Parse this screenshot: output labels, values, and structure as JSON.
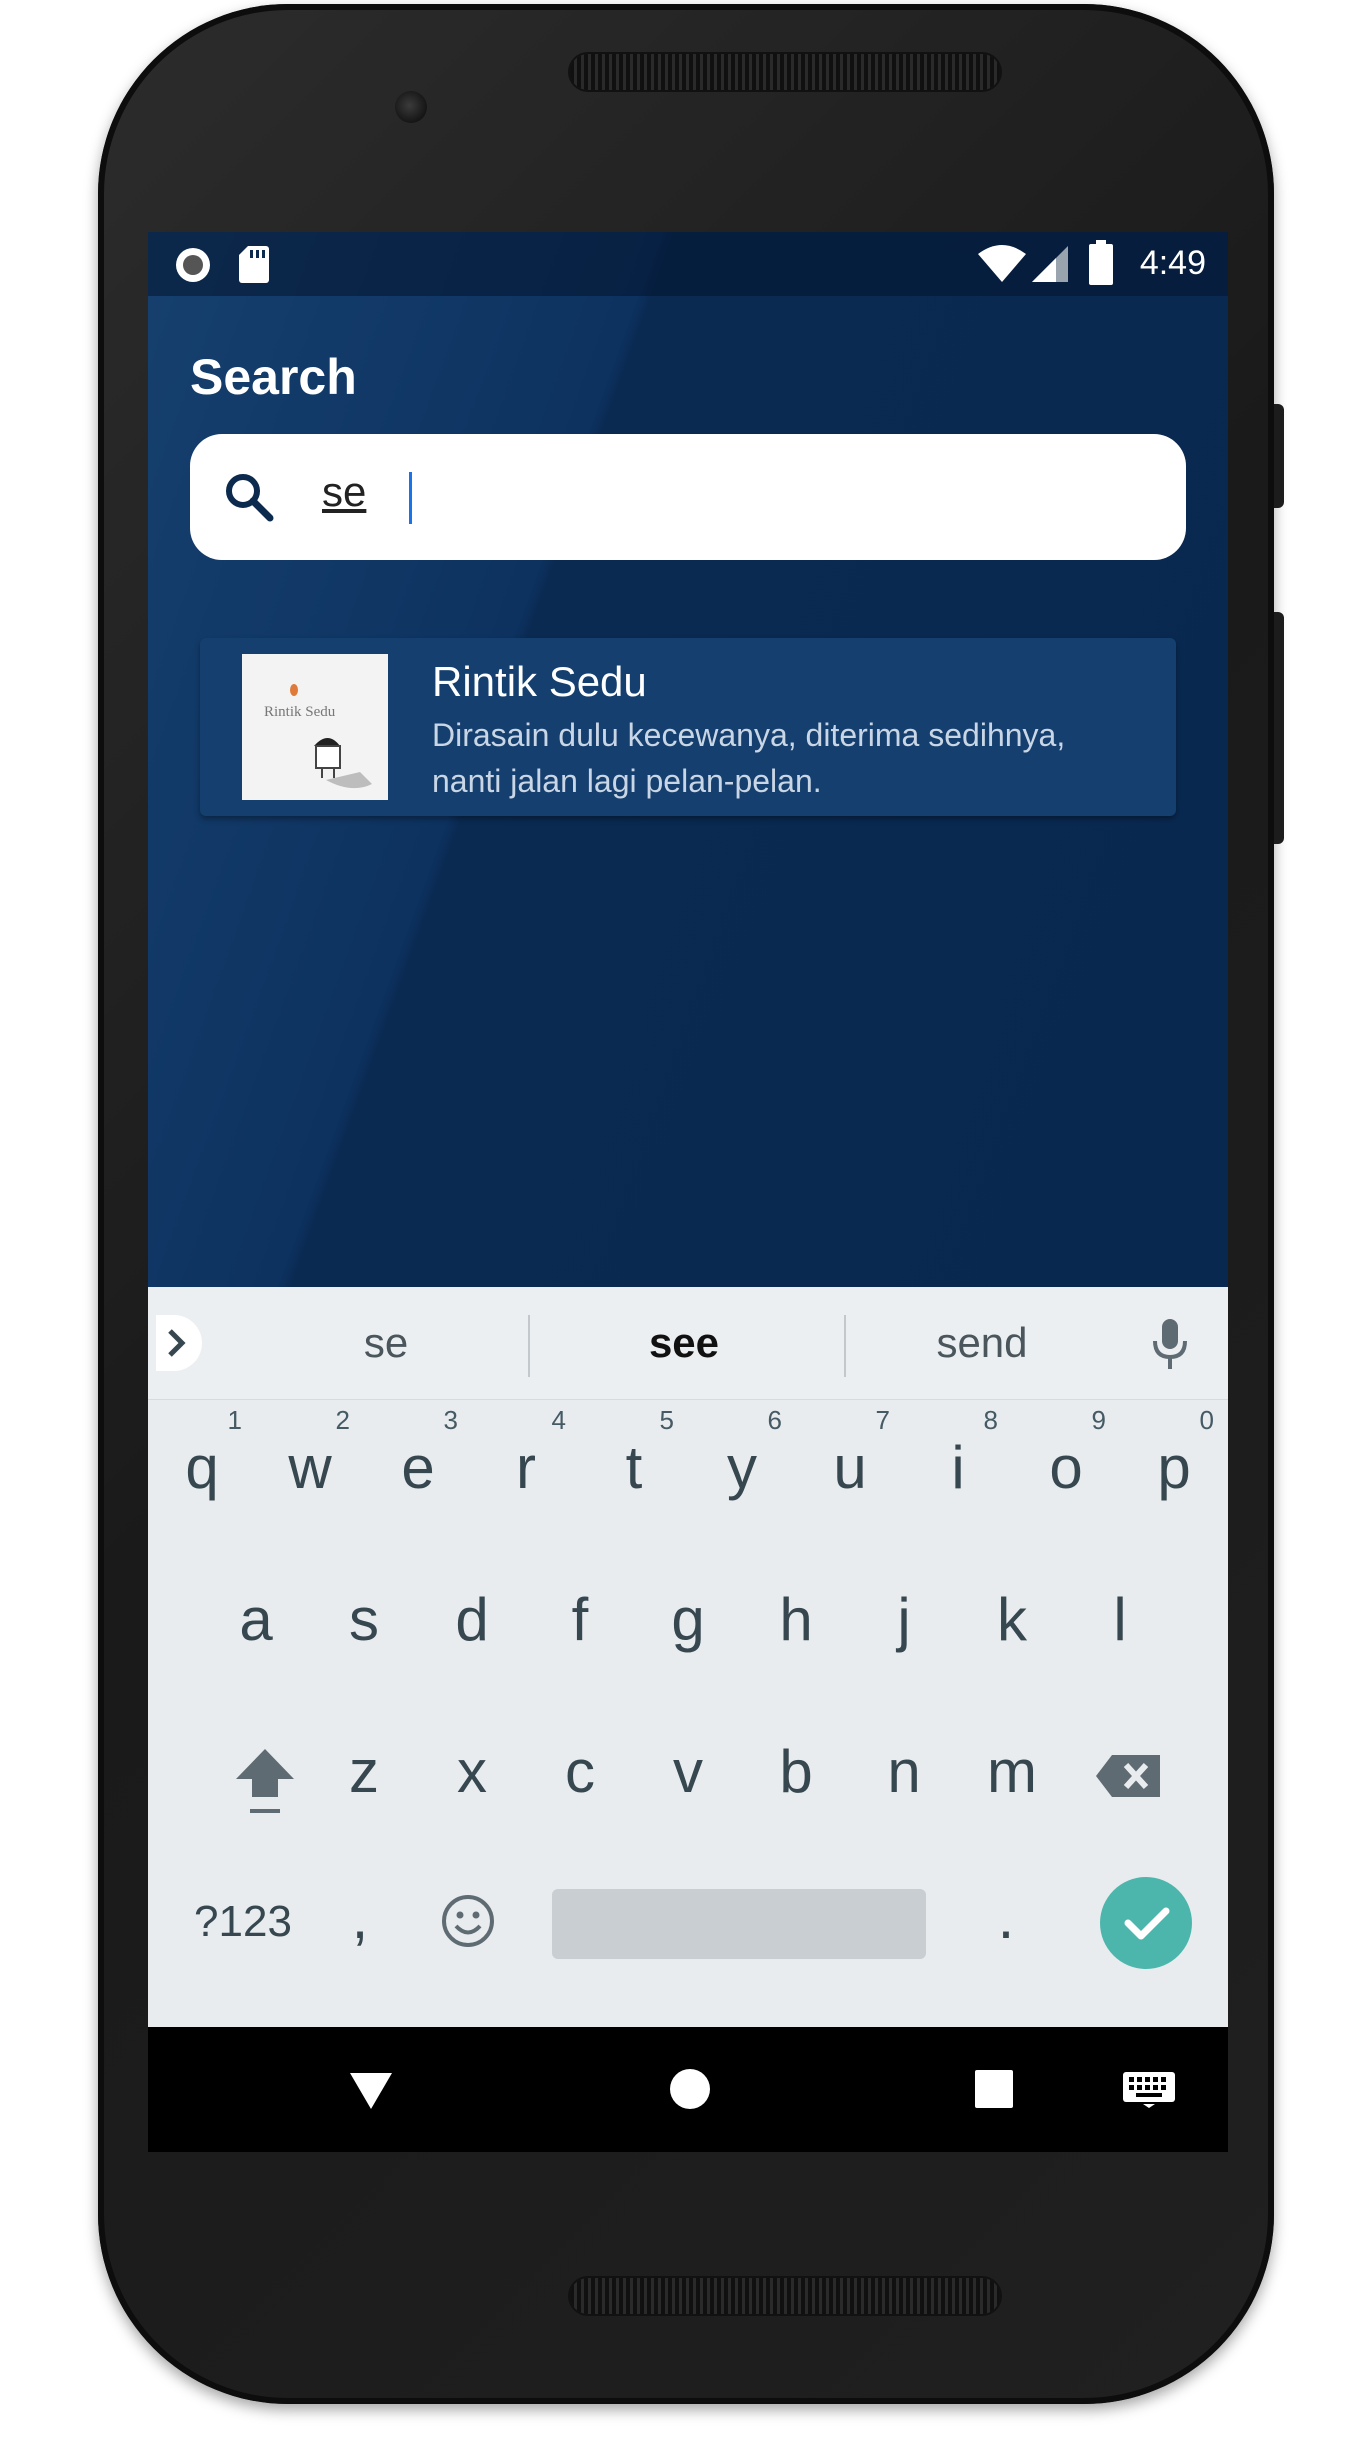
{
  "status_bar": {
    "time": "4:49",
    "icons": [
      "record-icon",
      "sd-card-icon",
      "wifi-icon",
      "signal-icon",
      "battery-icon"
    ]
  },
  "header": {
    "title": "Search"
  },
  "search": {
    "value": "se",
    "icon": "search-icon"
  },
  "results": [
    {
      "title": "Rintik Sedu",
      "description": "Dirasain dulu kecewanya, diterima sedihnya, nanti jalan lagi pelan-pelan.",
      "cover_text": "Rintik Sedu"
    }
  ],
  "keyboard": {
    "suggestions": [
      "se",
      "see",
      "send"
    ],
    "row1": [
      "q",
      "w",
      "e",
      "r",
      "t",
      "y",
      "u",
      "i",
      "o",
      "p"
    ],
    "row1_hints": [
      "1",
      "2",
      "3",
      "4",
      "5",
      "6",
      "7",
      "8",
      "9",
      "0"
    ],
    "row2": [
      "a",
      "s",
      "d",
      "f",
      "g",
      "h",
      "j",
      "k",
      "l"
    ],
    "row3": [
      "z",
      "x",
      "c",
      "v",
      "b",
      "n",
      "m"
    ],
    "symbols_key": "?123",
    "comma_key": ",",
    "period_key": "."
  },
  "nav_bar": {
    "icons": [
      "back-icon",
      "home-icon",
      "recents-icon",
      "keyboard-icon"
    ]
  },
  "colors": {
    "app_background": "#0a2a52",
    "card_background": "#153f6e",
    "enter_key": "#4db6ac",
    "caret": "#1a73e8"
  }
}
